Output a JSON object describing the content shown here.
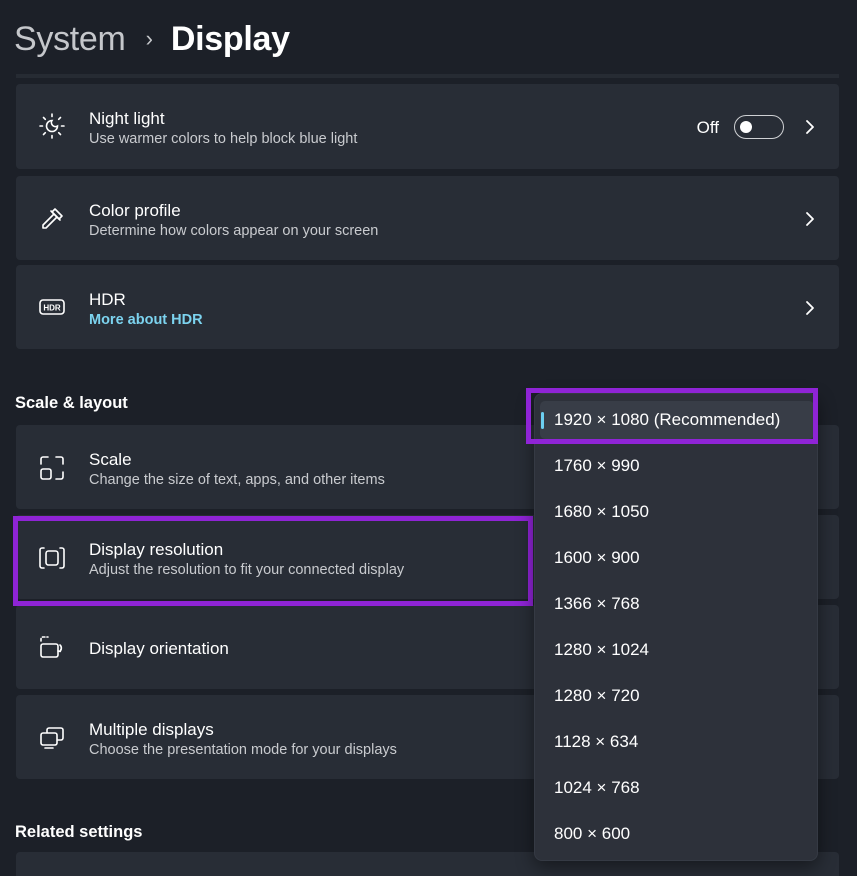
{
  "header": {
    "parent": "System",
    "separator": "›",
    "current": "Display"
  },
  "cards": {
    "night_light": {
      "title": "Night light",
      "subtitle": "Use warmer colors to help block blue light",
      "state": "Off"
    },
    "color_profile": {
      "title": "Color profile",
      "subtitle": "Determine how colors appear on your screen"
    },
    "hdr": {
      "title": "HDR",
      "subtitle": "More about HDR",
      "icon_text": "HDR"
    },
    "scale": {
      "title": "Scale",
      "subtitle": "Change the size of text, apps, and other items"
    },
    "display_resolution": {
      "title": "Display resolution",
      "subtitle": "Adjust the resolution to fit your connected display"
    },
    "display_orientation": {
      "title": "Display orientation"
    },
    "multiple_displays": {
      "title": "Multiple displays",
      "subtitle": "Choose the presentation mode for your displays"
    }
  },
  "sections": {
    "scale_layout": "Scale & layout",
    "related": "Related settings"
  },
  "resolution_dropdown": {
    "selected_index": 0,
    "options": [
      "1920 × 1080 (Recommended)",
      "1760 × 990",
      "1680 × 1050",
      "1600 × 900",
      "1366 × 768",
      "1280 × 1024",
      "1280 × 720",
      "1128 × 634",
      "1024 × 768",
      "800 × 600"
    ]
  },
  "colors": {
    "background": "#1c2028",
    "card": "#282d36",
    "accent": "#6ccff1",
    "link": "#7cd3ef",
    "highlight": "#8f24d6"
  },
  "icons": {
    "night_light": "sun-icon",
    "color_profile": "eyedropper-icon",
    "hdr": "hdr-icon",
    "scale": "scale-icon",
    "display_resolution": "resolution-icon",
    "display_orientation": "orientation-icon",
    "multiple_displays": "multiple-displays-icon",
    "chevron": "chevron-right-icon"
  }
}
